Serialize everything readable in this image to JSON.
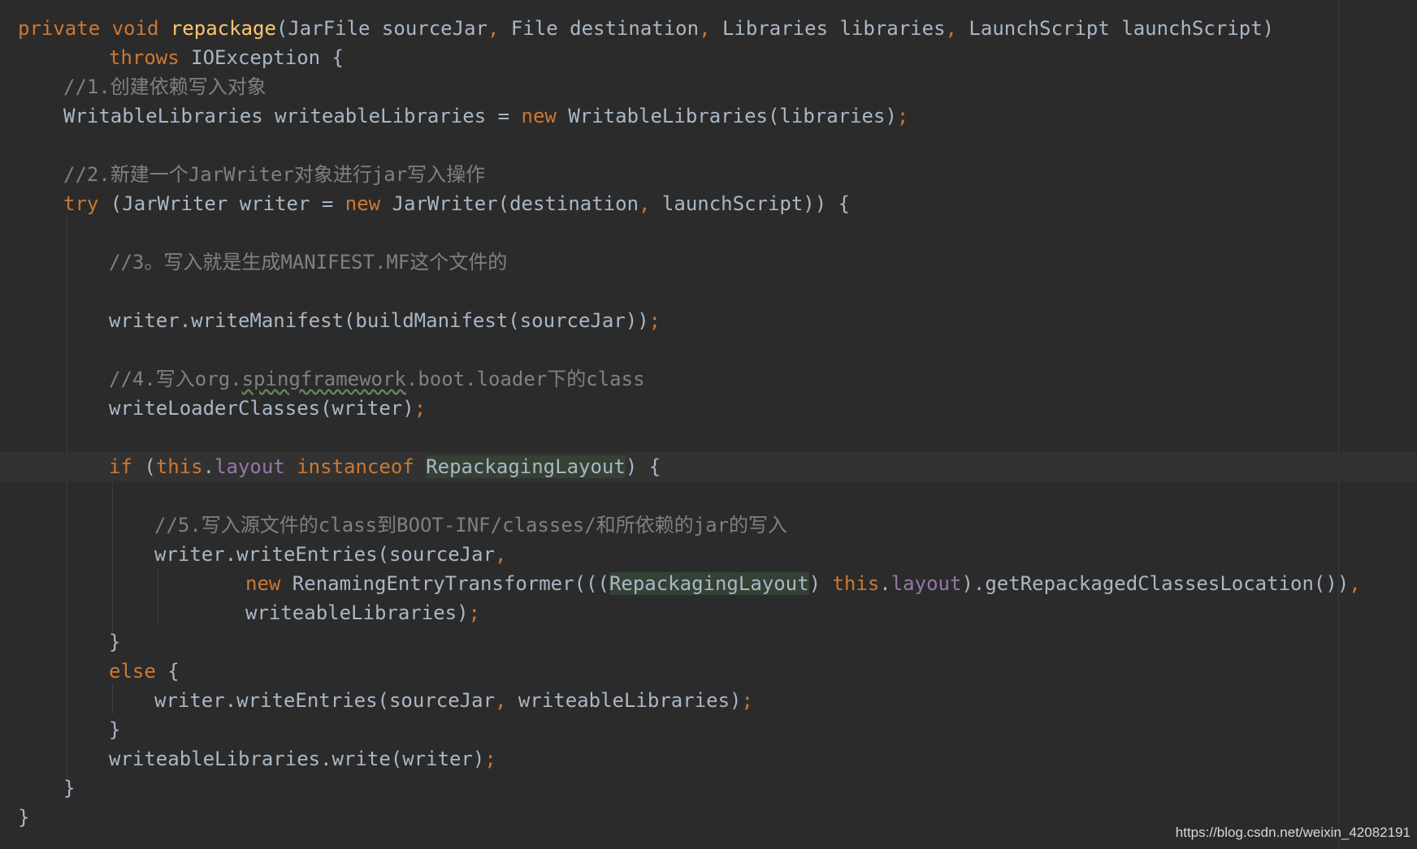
{
  "code": {
    "l1": {
      "kw": "private void ",
      "fn": "repackage",
      "a": "(JarFile sourceJar",
      "c1": ",",
      "b": " File destination",
      "c2": ",",
      "d": " Libraries libraries",
      "c3": ",",
      "e": " LaunchScript launchScript)"
    },
    "l2": {
      "kw": "throws ",
      "a": "IOException {"
    },
    "l3": {
      "cm": "//1.创建依赖写入对象"
    },
    "l4": {
      "a": "WritableLibraries writeableLibraries = ",
      "kw": "new ",
      "b": "WritableLibraries(libraries)",
      "semi": ";"
    },
    "l6": {
      "cm": "//2.新建一个JarWriter对象进行jar写入操作"
    },
    "l7": {
      "kw": "try ",
      "a": "(JarWriter writer = ",
      "kw2": "new ",
      "b": "JarWriter(destination",
      "c": ",",
      "d": " launchScript)) {"
    },
    "l9": {
      "cm": "//3。写入就是生成MANIFEST.MF这个文件的"
    },
    "l11": {
      "a": "writer.writeManifest(buildManifest(sourceJar))",
      "semi": ";"
    },
    "l13": {
      "cm1": "//4.写入org.",
      "wavy": "spingframework",
      "cm2": ".boot.loader下的class"
    },
    "l14": {
      "a": "writeLoaderClasses(writer)",
      "semi": ";"
    },
    "l16": {
      "kw": "if ",
      "a": "(",
      "kw2": "this",
      "b": ".",
      "fld": "layout",
      "sp": " ",
      "kw3": "instanceof ",
      "hl": "RepackagingLayout",
      "c": ") {"
    },
    "l18": {
      "cm": "//5.写入源文件的class到BOOT-INF/classes/和所依赖的jar的写入"
    },
    "l19": {
      "a": "writer.writeEntries(sourceJar",
      "c": ","
    },
    "l20": {
      "kw": "new ",
      "a": "RenamingEntryTransformer(((",
      "hl": "RepackagingLayout",
      "b": ") ",
      "kw2": "this",
      "c": ".",
      "fld": "layout",
      "d": ").getRepackagedClassesLocation())",
      "comma": ","
    },
    "l21": {
      "a": "writeableLibraries)",
      "semi": ";"
    },
    "l22": {
      "a": "}"
    },
    "l23": {
      "kw": "else ",
      "a": "{"
    },
    "l24": {
      "a": "writer.writeEntries(sourceJar",
      "c": ",",
      "b": " writeableLibraries)",
      "semi": ";"
    },
    "l25": {
      "a": "}"
    },
    "l26": {
      "a": "writeableLibraries.write(writer)",
      "semi": ";"
    },
    "l27": {
      "a": "}"
    },
    "l28": {
      "a": "}"
    }
  },
  "watermark": "https://blog.csdn.net/weixin_42082191",
  "colors": {
    "background": "#2b2b2b",
    "keyword": "#cc7832",
    "method_declaration": "#ffc66d",
    "field": "#9876aa",
    "comment": "#808080",
    "text": "#a9b7c6"
  }
}
